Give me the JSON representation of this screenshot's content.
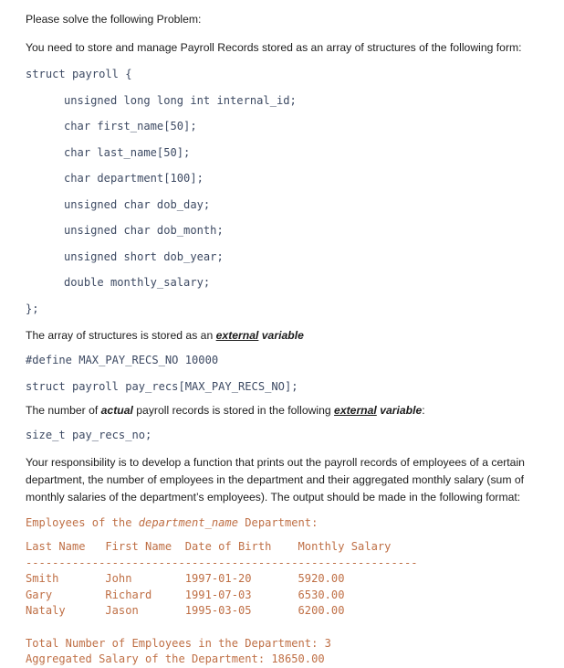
{
  "document": {
    "intro_line": "Please solve the following Problem:",
    "problem_statement": "You need to store and manage Payroll Records stored as an array of structures of the following form:",
    "struct_open": "struct payroll {",
    "struct_members": [
      "unsigned long long int internal_id;",
      "char first_name[50];",
      "char last_name[50];",
      "char department[100];",
      "unsigned char dob_day;",
      "unsigned char dob_month;",
      "unsigned short dob_year;",
      "double monthly_salary;"
    ],
    "struct_close": "};",
    "array_note": {
      "lead": "The array of structures is stored as an ",
      "emph_underline": "external",
      "emph_space": " ",
      "emph_plain": "variable",
      "trail": ""
    },
    "define_line": "#define MAX_PAY_RECS_NO 10000",
    "array_decl_line": "struct payroll pay_recs[MAX_PAY_RECS_NO];",
    "count_note": {
      "lead": "The number of ",
      "emph_actual": "actual",
      "mid": " payroll records is stored in the following ",
      "emph_underline": "external",
      "emph_space": " ",
      "emph_plain": "variable",
      "trail": ":"
    },
    "size_decl_line": "size_t pay_recs_no;",
    "responsibility_paragraph": "Your responsibility is to develop a function that prints out the payroll records of employees of a certain department, the number of employees in the department and their aggregated monthly salary (sum of monthly salaries of the department’s employees). The output should be made in the following format:",
    "output_sample": {
      "header_lead": "Employees of the ",
      "header_placeholder": "department_name",
      "header_trail": " Department:",
      "column_header": "Last Name   First Name  Date of Birth    Monthly Salary",
      "separator": "-----------------------------------------------------------",
      "rows": [
        "Smith       John        1997-01-20       5920.00",
        "Gary        Richard     1991-07-03       6530.00",
        "Nataly      Jason       1995-03-05       6200.00"
      ],
      "total_line": "Total Number of Employees in the Department: 3",
      "aggregate_line": "Aggregated Salary of the Department: 18650.00"
    },
    "table_data": {
      "columns": [
        "Last Name",
        "First Name",
        "Date of Birth",
        "Monthly Salary"
      ],
      "records": [
        {
          "last_name": "Smith",
          "first_name": "John",
          "date_of_birth": "1997-01-20",
          "monthly_salary": "5920.00"
        },
        {
          "last_name": "Gary",
          "first_name": "Richard",
          "date_of_birth": "1991-07-03",
          "monthly_salary": "6530.00"
        },
        {
          "last_name": "Nataly",
          "first_name": "Jason",
          "date_of_birth": "1995-03-05",
          "monthly_salary": "6200.00"
        }
      ],
      "total_employees": "3",
      "aggregated_salary": "18650.00"
    },
    "colors": {
      "code_blue": "#3d4a63",
      "terminal_orange": "#bf6f45",
      "body_text": "#1c1c1c",
      "page_background": "#ffffff"
    }
  }
}
